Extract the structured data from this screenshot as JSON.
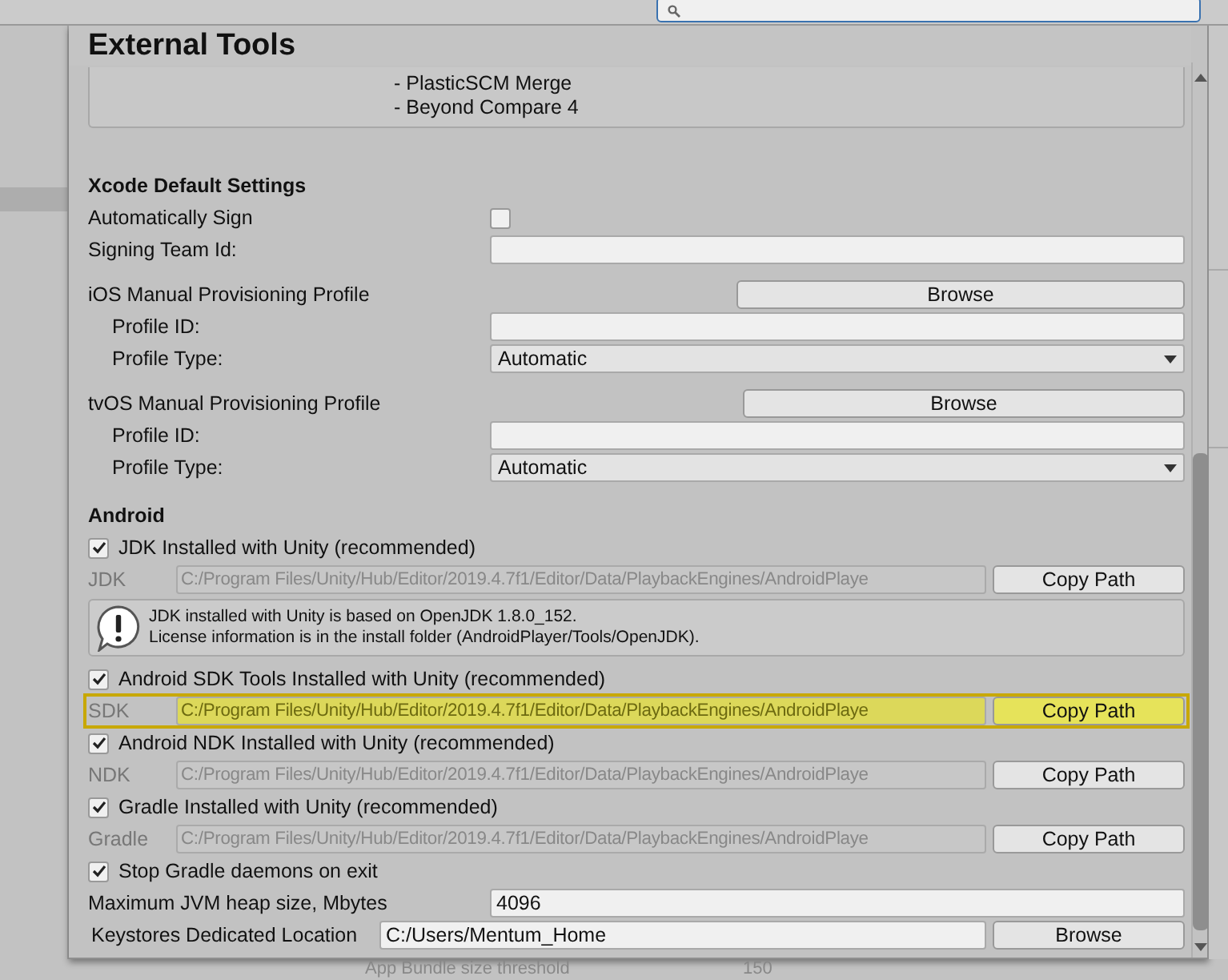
{
  "background": {
    "search": {
      "kind": "search"
    },
    "behind_row": {
      "label": "App Bundle size threshold",
      "value": "150"
    }
  },
  "panel": {
    "title": "External Tools",
    "merge_tools": [
      "- PlasticSCM Merge",
      "- Beyond Compare 4"
    ],
    "xcode": {
      "title": "Xcode Default Settings",
      "auto_sign": {
        "label": "Automatically Sign",
        "checked": false
      },
      "signing_team": {
        "label": "Signing Team Id:"
      },
      "profiles": [
        {
          "title": "iOS Manual Provisioning Profile",
          "button": "Browse",
          "id_label": "Profile ID:",
          "type_label": "Profile Type:",
          "type_value": "Automatic"
        },
        {
          "title": "tvOS Manual Provisioning Profile",
          "button": "Browse",
          "id_label": "Profile ID:",
          "type_label": "Profile Type:",
          "type_value": "Automatic"
        }
      ]
    },
    "android": {
      "title": "Android",
      "rows": [
        {
          "kind": "toggle",
          "label": "JDK Installed with Unity (recommended)",
          "checked": true
        },
        {
          "kind": "path",
          "label": "JDK",
          "value": "C:/Program Files/Unity/Hub/Editor/2019.4.7f1/Editor/Data/PlaybackEngines/AndroidPlaye",
          "button": "Copy Path",
          "highlighted": false
        },
        {
          "kind": "info",
          "lines": [
            "JDK installed with Unity is based on OpenJDK 1.8.0_152.",
            "License information is in the install folder (AndroidPlayer/Tools/OpenJDK)."
          ]
        },
        {
          "kind": "toggle",
          "label": "Android SDK Tools Installed with Unity (recommended)",
          "checked": true
        },
        {
          "kind": "path",
          "label": "SDK",
          "value": "C:/Program Files/Unity/Hub/Editor/2019.4.7f1/Editor/Data/PlaybackEngines/AndroidPlaye",
          "button": "Copy Path",
          "highlighted": true
        },
        {
          "kind": "toggle",
          "label": "Android NDK Installed with Unity (recommended)",
          "checked": true
        },
        {
          "kind": "path",
          "label": "NDK",
          "value": "C:/Program Files/Unity/Hub/Editor/2019.4.7f1/Editor/Data/PlaybackEngines/AndroidPlaye",
          "button": "Copy Path",
          "highlighted": false
        },
        {
          "kind": "toggle",
          "label": "Gradle Installed with Unity (recommended)",
          "checked": true
        },
        {
          "kind": "path",
          "label": "Gradle",
          "value": "C:/Program Files/Unity/Hub/Editor/2019.4.7f1/Editor/Data/PlaybackEngines/AndroidPlaye",
          "button": "Copy Path",
          "highlighted": false
        },
        {
          "kind": "toggle",
          "label": "Stop Gradle daemons on exit",
          "checked": true
        },
        {
          "kind": "field",
          "label": "Maximum JVM heap size, Mbytes",
          "value": "4096"
        },
        {
          "kind": "location",
          "label": "Keystores Dedicated Location",
          "value": "C:/Users/Mentum_Home",
          "button": "Browse"
        }
      ]
    }
  }
}
